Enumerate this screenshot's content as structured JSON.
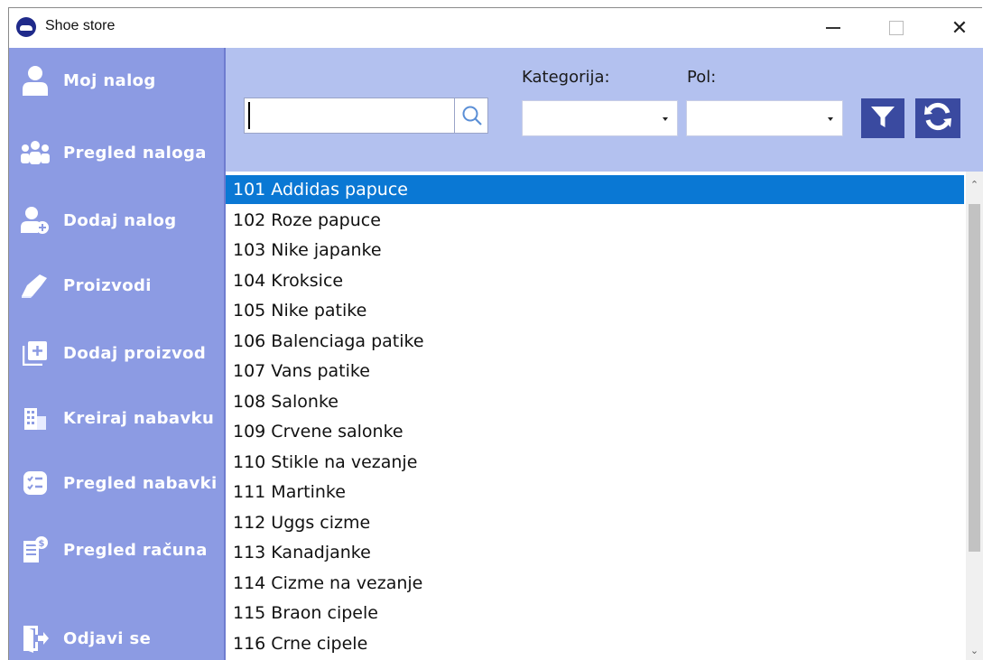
{
  "window": {
    "title": "Shoe store"
  },
  "sidebar": {
    "items": [
      {
        "label": "Moj nalog",
        "icon": "user-icon"
      },
      {
        "label": "Pregled naloga",
        "icon": "users-group-icon"
      },
      {
        "label": "Dodaj nalog",
        "icon": "user-add-icon"
      },
      {
        "label": "Proizvodi",
        "icon": "shoe-icon"
      },
      {
        "label": "Dodaj proizvod",
        "icon": "add-box-icon"
      },
      {
        "label": "Kreiraj nabavku",
        "icon": "building-icon"
      },
      {
        "label": "Pregled nabavki",
        "icon": "checklist-icon"
      },
      {
        "label": "Pregled računa",
        "icon": "receipt-icon"
      },
      {
        "label": "Odjavi se",
        "icon": "logout-icon"
      }
    ]
  },
  "filters": {
    "search_value": "",
    "kategorija_label": "Kategorija:",
    "kategorija_value": "",
    "pol_label": "Pol:",
    "pol_value": ""
  },
  "products": [
    "101 Addidas papuce",
    "102 Roze papuce",
    "103 Nike japanke",
    "104 Kroksice",
    "105 Nike patike",
    "106 Balenciaga patike",
    "107 Vans patike",
    "108 Salonke",
    "109 Crvene salonke",
    "110 Stikle na vezanje",
    "111 Martinke",
    "112 Uggs cizme",
    "113 Kanadjanke",
    "114 Cizme na vezanje",
    "115 Braon cipele",
    "116 Crne cipele"
  ],
  "selected_index": 0,
  "colors": {
    "sidebar_bg": "#8c9be3",
    "topbar_bg": "#b3c1ef",
    "selection": "#0a78d4",
    "icon_button": "#3a4aa0"
  }
}
